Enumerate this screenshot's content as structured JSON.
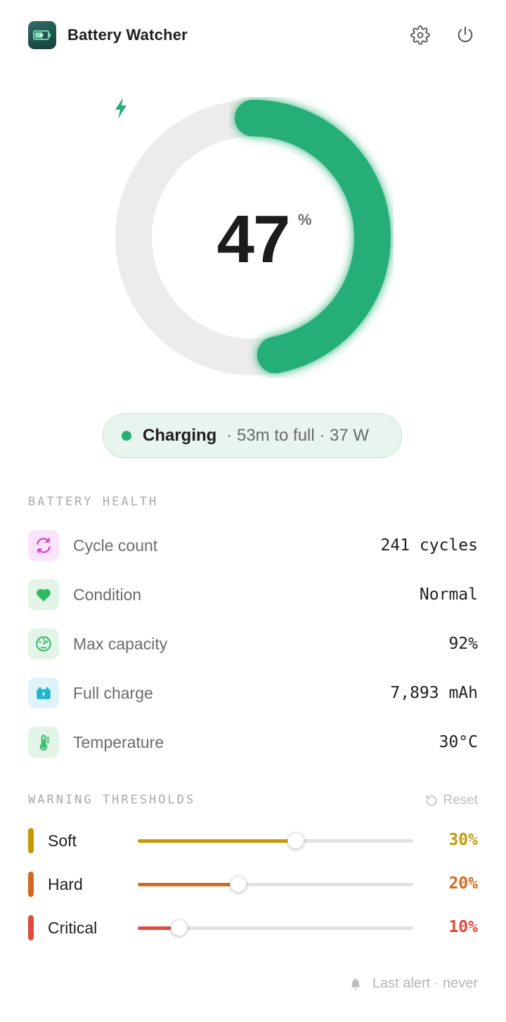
{
  "app": {
    "title": "Battery Watcher",
    "icon": "battery-charging-icon"
  },
  "header": {
    "settings_icon": "gear-icon",
    "power_icon": "power-icon"
  },
  "battery": {
    "percent": 47,
    "percent_display": "47",
    "unit": "%",
    "charging_icon": "lightning-bolt-icon",
    "colors": {
      "ring_fill": "#27ae78",
      "ring_track": "#ececec"
    }
  },
  "status": {
    "label": "Charging",
    "detail": "· 53m to full · 37 W",
    "color": "#27ae78"
  },
  "health": {
    "section_label": "BATTERY HEALTH",
    "rows": [
      {
        "label": "Cycle count",
        "value": "241 cycles",
        "icon": "cycle-icon",
        "color": "#d63ad6",
        "bg": "#fbe3fb"
      },
      {
        "label": "Condition",
        "value": "Normal",
        "icon": "heart-icon",
        "color": "#2fb865",
        "bg": "#e2f5e8"
      },
      {
        "label": "Max capacity",
        "value": "92%",
        "icon": "gauge-icon",
        "color": "#2fb865",
        "bg": "#e2f5e8"
      },
      {
        "label": "Full charge",
        "value": "7,893 mAh",
        "icon": "battery-icon",
        "color": "#1fb3cc",
        "bg": "#dff4f8"
      },
      {
        "label": "Temperature",
        "value": "30°C",
        "icon": "thermometer-icon",
        "color": "#2fb865",
        "bg": "#e2f5e8"
      }
    ]
  },
  "thresholds": {
    "section_label": "WARNING THRESHOLDS",
    "reset_label": "Reset",
    "reset_icon": "reset-icon",
    "rows": [
      {
        "label": "Soft",
        "value": "30%",
        "fraction": 0.575,
        "color": "#c39a05"
      },
      {
        "label": "Hard",
        "value": "20%",
        "fraction": 0.365,
        "color": "#d46a22"
      },
      {
        "label": "Critical",
        "value": "10%",
        "fraction": 0.15,
        "color": "#e24a3c"
      }
    ]
  },
  "footer": {
    "label": "Last alert · never",
    "icon": "bell-icon"
  }
}
